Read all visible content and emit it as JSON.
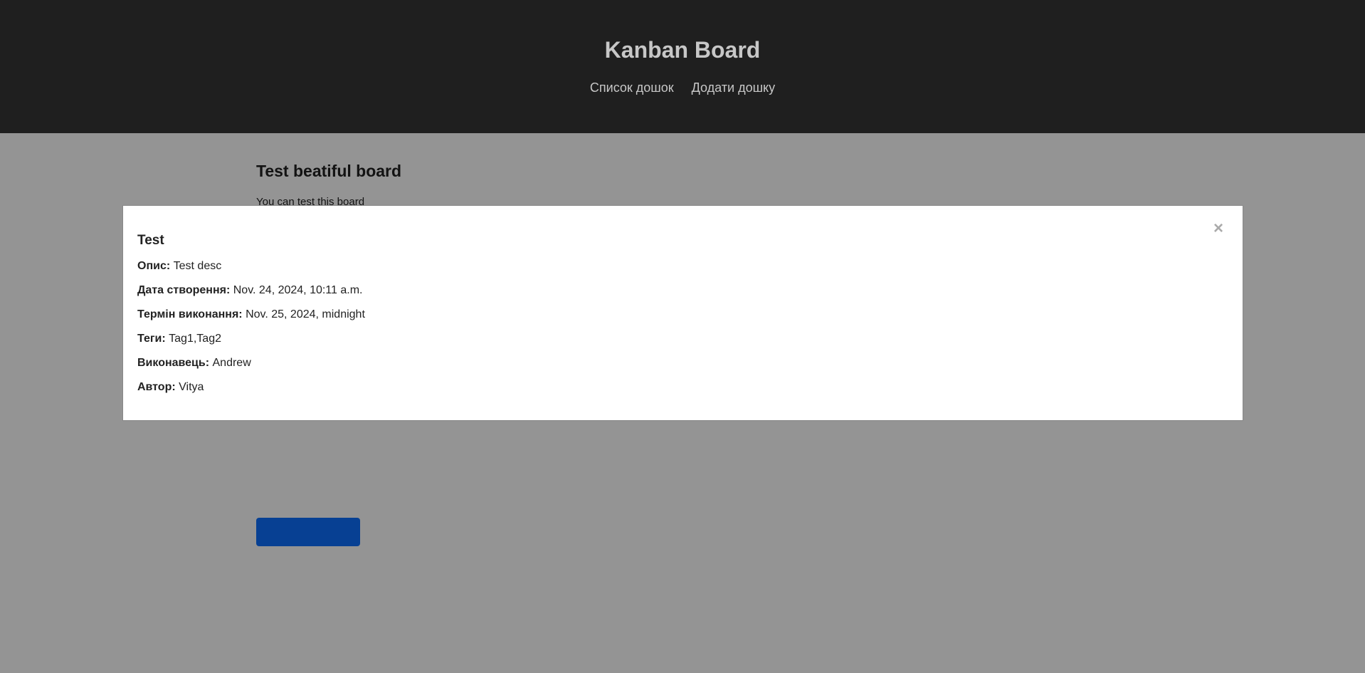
{
  "header": {
    "title": "Kanban Board",
    "nav": [
      "Список дошок",
      "Додати дошку"
    ]
  },
  "board": {
    "title": "Test beatiful board",
    "description": "You can test this board"
  },
  "modal": {
    "close_glyph": "×",
    "title": "Test",
    "fields": [
      {
        "label": "Опис:",
        "value": "Test desc"
      },
      {
        "label": "Дата створення:",
        "value": "Nov. 24, 2024, 10:11 a.m."
      },
      {
        "label": "Термін виконання:",
        "value": "Nov. 25, 2024, midnight"
      },
      {
        "label": "Теги:",
        "value": "Tag1,Tag2"
      },
      {
        "label": "Виконавець:",
        "value": "Andrew"
      },
      {
        "label": "Автор:",
        "value": "Vitya"
      }
    ]
  },
  "colors": {
    "header_bg": "#1f1f1f",
    "header_text": "#c7c7c7",
    "accent_button": "#0d6efd",
    "overlay": "rgba(0,0,0,0.42)"
  }
}
